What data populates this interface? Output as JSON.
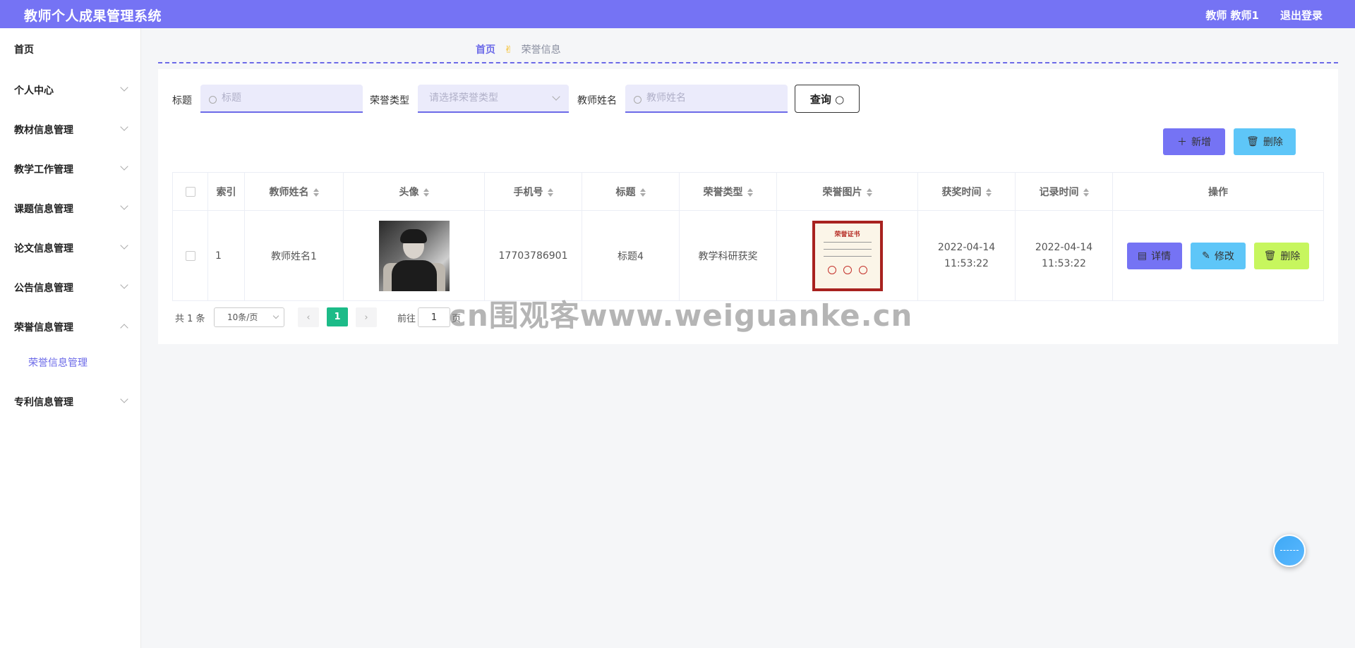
{
  "header": {
    "title": "教师个人成果管理系统",
    "user": "教师 教师1",
    "logout": "退出登录"
  },
  "sidebar": {
    "items": [
      {
        "label": "首页"
      },
      {
        "label": "个人中心"
      },
      {
        "label": "教材信息管理"
      },
      {
        "label": "教学工作管理"
      },
      {
        "label": "课题信息管理"
      },
      {
        "label": "论文信息管理"
      },
      {
        "label": "公告信息管理"
      },
      {
        "label": "荣誉信息管理"
      },
      {
        "label": "专利信息管理"
      }
    ],
    "active_sub": "荣誉信息管理"
  },
  "breadcrumb": {
    "home": "首页",
    "current": "荣誉信息"
  },
  "filters": {
    "title_label": "标题",
    "title_placeholder": "标题",
    "type_label": "荣誉类型",
    "type_placeholder": "请选择荣誉类型",
    "teacher_label": "教师姓名",
    "teacher_placeholder": "教师姓名",
    "query": "查询"
  },
  "actions": {
    "add": "新增",
    "delete": "删除"
  },
  "table": {
    "headers": [
      "索引",
      "教师姓名",
      "头像",
      "手机号",
      "标题",
      "荣誉类型",
      "荣誉图片",
      "获奖时间",
      "记录时间",
      "操作"
    ],
    "rows": [
      {
        "index": "1",
        "teacher": "教师姓名1",
        "phone": "17703786901",
        "title": "标题4",
        "type": "教学科研获奖",
        "award_time": "2022-04-14 11:53:22",
        "record_time": "2022-04-14 11:53:22"
      }
    ],
    "row_actions": {
      "detail": "详情",
      "edit": "修改",
      "delete": "删除"
    },
    "cert_title": "荣誉证书"
  },
  "pagination": {
    "total": "共 1 条",
    "page_size": "10条/页",
    "current": "1",
    "goto": "前往",
    "goto_value": "1",
    "page_suffix": "页"
  },
  "watermark": "cn围观客www.weiguanke.cn",
  "colors": {
    "brand": "#7573f4",
    "info": "#5ec6f8",
    "success": "#1cbb88",
    "lime": "#c7f65e"
  }
}
